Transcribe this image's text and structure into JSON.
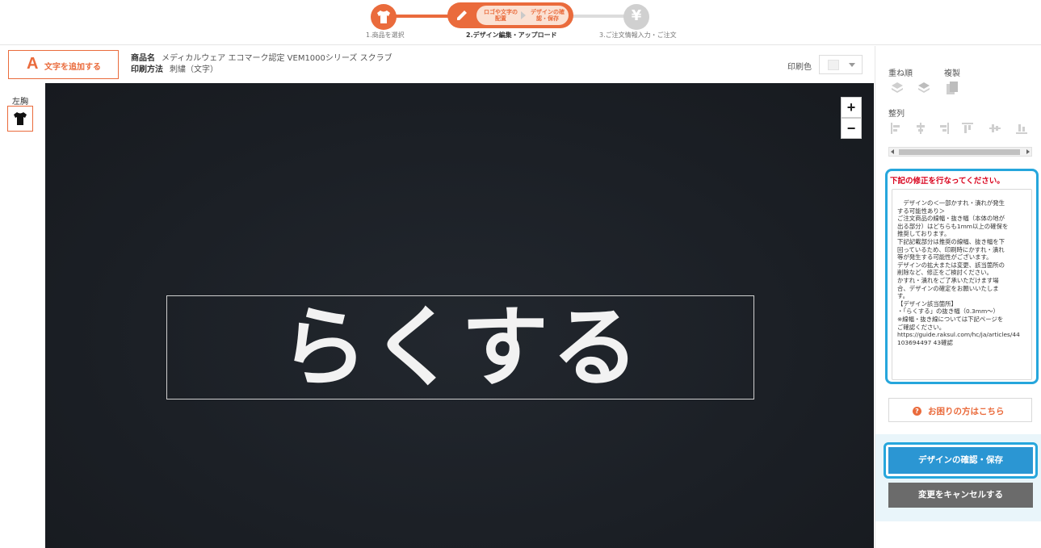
{
  "steps": [
    {
      "label": "1.商品を選択",
      "icon": "tshirt-icon",
      "state": "done"
    },
    {
      "label": "2.デザイン編集・アップロード",
      "icon": "pencil-icon",
      "state": "active",
      "sub_a": "ロゴや文字の配置",
      "sub_b": "デザインの確認・保存"
    },
    {
      "label": "3.ご注文情報入力・ご注文",
      "icon": "yen-icon",
      "state": "pending",
      "glyph": "¥"
    }
  ],
  "toolbar": {
    "add_text_icon": "A",
    "add_text_label": "文字を追加する",
    "product_name_label": "商品名",
    "product_name_value": "メディカルウェア エコマーク認定 VEM1000シリーズ スクラブ",
    "print_method_label": "印刷方法",
    "print_method_value": "刺繍（文字）",
    "print_color_label": "印刷色"
  },
  "left_panel": {
    "position_label": "左胸"
  },
  "canvas": {
    "zoom_in": "+",
    "zoom_out": "−",
    "design_text": "らくする"
  },
  "right_panel": {
    "layer_order_label": "重ね順",
    "duplicate_label": "複製",
    "align_label": "整列",
    "warning_title": "下記の修正を行なってください。",
    "warning_lines": [
      "　デザインの＜一部かすれ・潰れが発生",
      "する可能性あり＞",
      "ご注文商品の線幅・抜き幅（本体の地が",
      "出る部分）はどちらも1mm以上の確保を",
      "推奨しております。",
      "下記記載部分は推奨の線幅、抜き幅を下",
      "回っているため、印刷時にかすれ・潰れ",
      "等が発生する可能性がございます。",
      "デザインの拡大または変更、該当箇所の",
      "削除など、修正をご検討ください。",
      "かすれ・潰れをご了承いただけます場",
      "合、デザインの確定をお願いいたしま",
      "す。",
      "",
      "【デザイン該当箇所】",
      "・「らくする」の抜き幅（0.3mm～）",
      "",
      "※線幅・抜き線については下記ページを",
      "ご確認ください。",
      "https://guide.raksul.com/hc/ja/articles/44",
      "103694497 43確認"
    ],
    "help_label": "お困りの方はこちら",
    "confirm_label": "デザインの確認・保存",
    "cancel_label": "変更をキャンセルする"
  },
  "colors": {
    "accent": "#ea6b3c",
    "primary_blue": "#2b96d3",
    "highlight_ring": "#26a6dc",
    "warning_red": "#d9001b",
    "canvas_bg": "#1b1f25"
  }
}
